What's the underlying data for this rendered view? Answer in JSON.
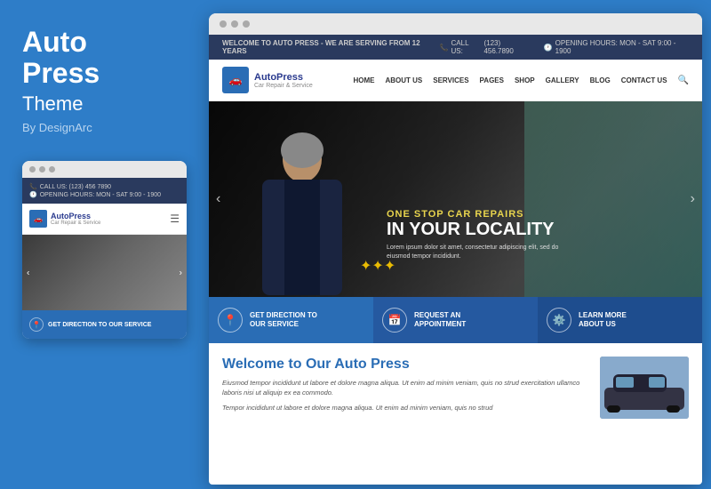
{
  "left": {
    "title_line1": "Auto",
    "title_line2": "Press",
    "subtitle": "Theme",
    "author": "By DesignArc"
  },
  "mobile": {
    "topbar": {
      "phone": "CALL US: (123) 456 7890",
      "hours": "OPENING HOURS: MON - SAT 9:00 - 1900"
    },
    "logo": {
      "name": "AutoPress",
      "tagline": "Car Repair & Service"
    },
    "cta": {
      "label": "GET DIRECTION TO OUR SERVICE"
    }
  },
  "browser": {
    "topbar": {
      "welcome": "WELCOME TO AUTO PRESS - WE ARE SERVING FROM 12 YEARS",
      "phone_label": "CALL US:",
      "phone": "(123) 456.7890",
      "hours_label": "OPENING HOURS: MON - SAT 9:00 - 1900"
    },
    "nav": {
      "logo_name": "AutoPress",
      "logo_tagline": "Car Repair & Service",
      "links": [
        "HOME",
        "ABOUT US",
        "SERVICES",
        "PAGES",
        "SHOP",
        "GALLERY",
        "BLOG",
        "CONTACT US"
      ]
    },
    "hero": {
      "sub": "ONE STOP CAR REPAIRS",
      "main": "IN YOUR LOCALITY",
      "para": "Lorem ipsum dolor sit amet, consectetur adipiscing elit, sed do eiusmod tempor incididunt."
    },
    "cta_items": [
      {
        "icon": "📍",
        "label": "GET DIRECTION TO\nOUR SERVICE"
      },
      {
        "icon": "📅",
        "label": "REQUEST AN\nAPPOINTMENT"
      },
      {
        "icon": "⚙️",
        "label": "LEARN MORE\nABOUT US"
      }
    ],
    "welcome": {
      "title_plain": "Welcome to Our ",
      "title_colored": "Auto Press",
      "para1": "Eiusmod tempor incididunt ut labore et dolore magna aliqua. Ut enim ad minim veniam, quis no strud exercitation ullamco laboris nisi ut aliquip ex ea commodo.",
      "para2": "Tempor incididunt ut labore et dolore magna aliqua. Ut enim ad minim veniam, quis no strud"
    }
  }
}
